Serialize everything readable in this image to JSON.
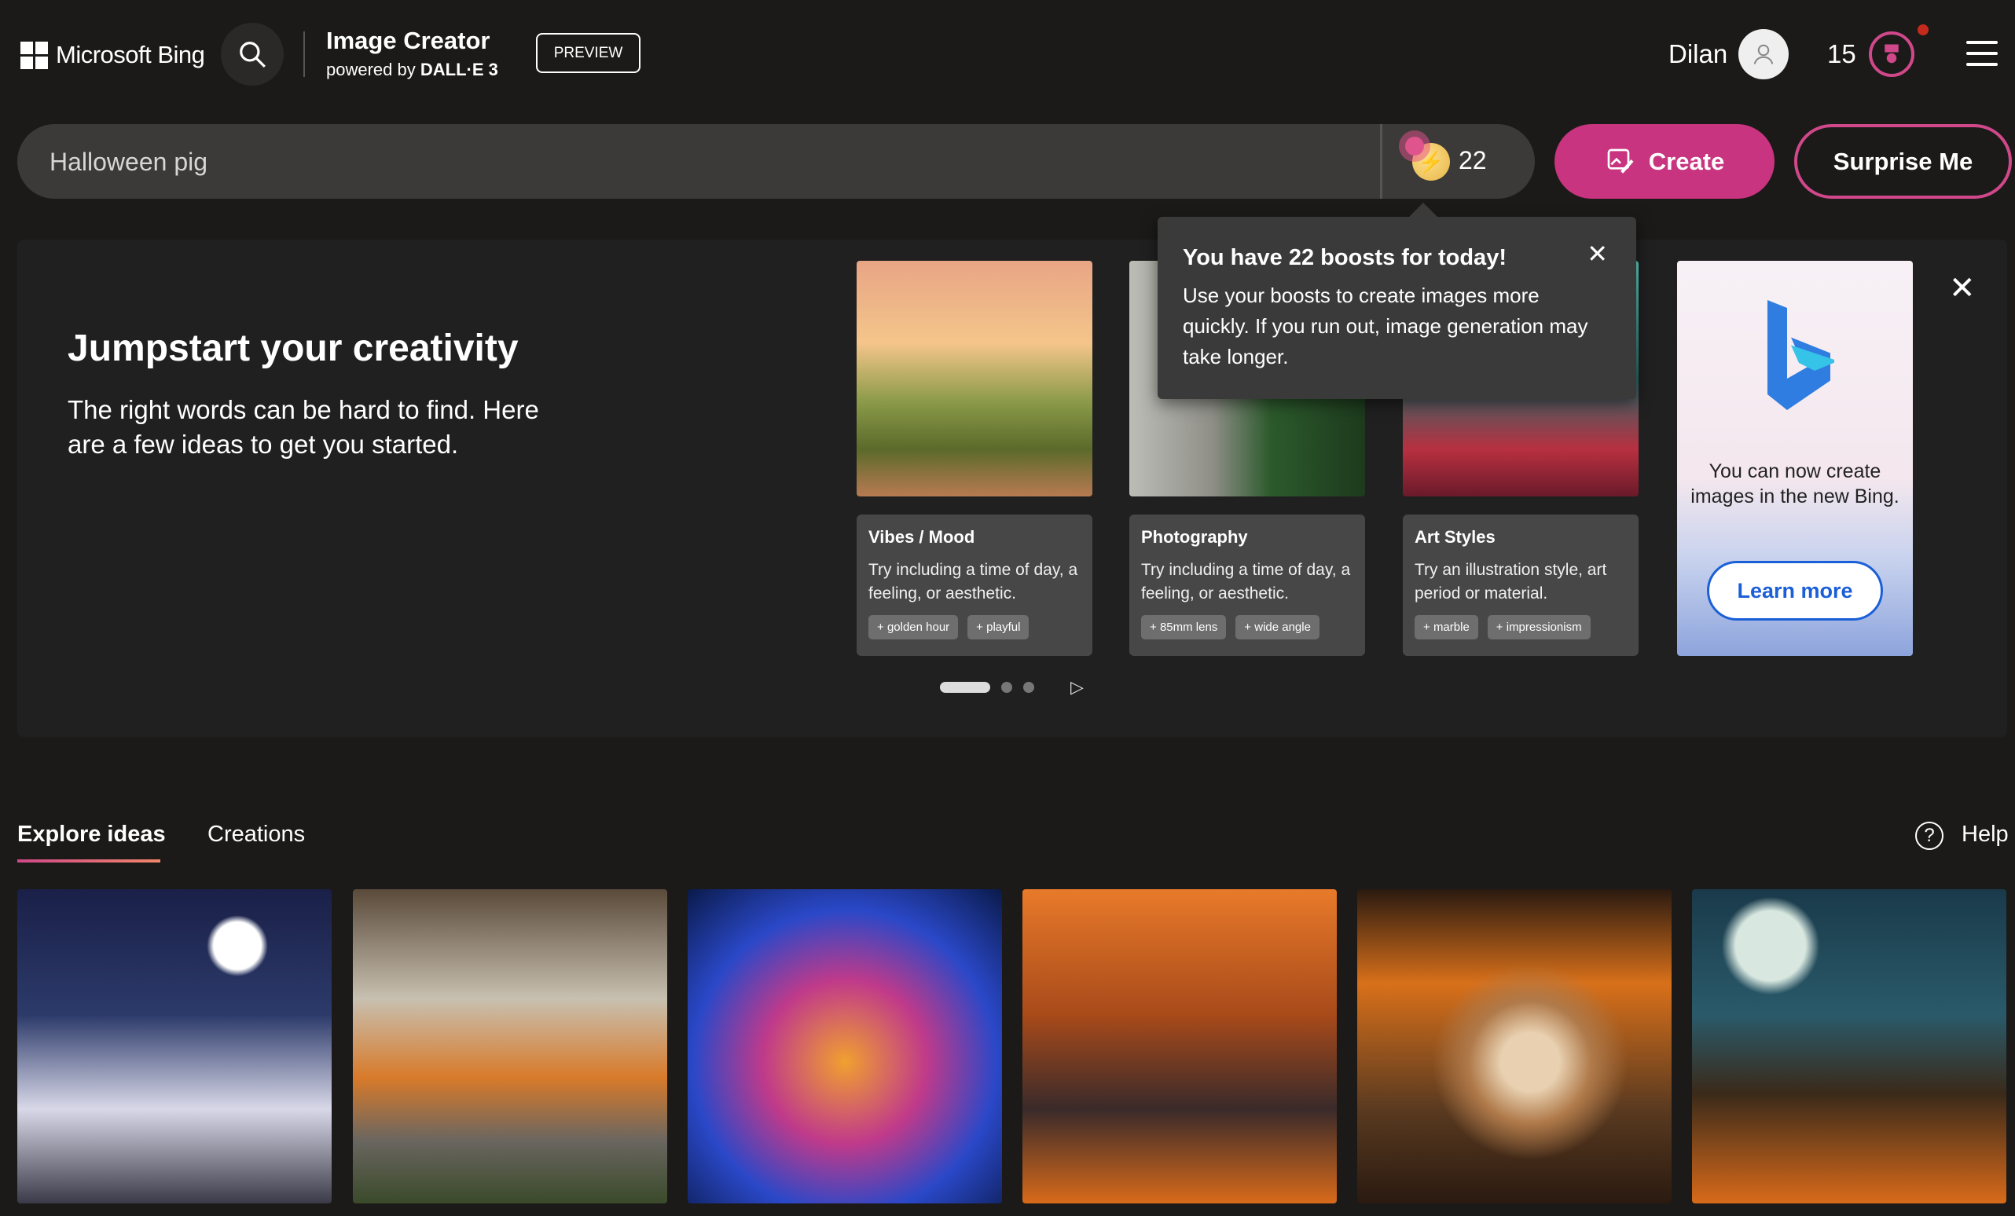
{
  "header": {
    "brand": "Microsoft Bing",
    "title": "Image Creator",
    "powered_prefix": "powered by",
    "powered_brand": "DALL·E 3",
    "preview": "PREVIEW",
    "user_name": "Dilan",
    "points": "15"
  },
  "search": {
    "value": "Halloween pig",
    "boosts": "22",
    "create": "Create",
    "surprise": "Surprise Me"
  },
  "tooltip": {
    "title": "You have 22 boosts for today!",
    "body": "Use your boosts to create images more quickly. If you run out, image generation may take longer."
  },
  "jumpstart": {
    "title": "Jumpstart your creativity",
    "subtitle": "The right words can be hard to find. Here are a few ideas to get you started.",
    "cards": [
      {
        "title": "Vibes / Mood",
        "desc": "Try including a time of day, a feeling, or aesthetic.",
        "chips": [
          "golden hour",
          "playful"
        ]
      },
      {
        "title": "Photography",
        "desc": "Try including a time of day, a feeling, or aesthetic.",
        "chips": [
          "85mm lens",
          "wide angle"
        ]
      },
      {
        "title": "Art Styles",
        "desc": "Try an illustration style, art period or material.",
        "chips": [
          "marble",
          "impressionism"
        ]
      }
    ],
    "bing_card": {
      "text": "You can now create images in the new Bing.",
      "button": "Learn more"
    }
  },
  "tabs": {
    "explore": "Explore ideas",
    "creations": "Creations",
    "help": "Help"
  },
  "colors": {
    "accent": "#c8347f",
    "background": "#1b1a19"
  }
}
